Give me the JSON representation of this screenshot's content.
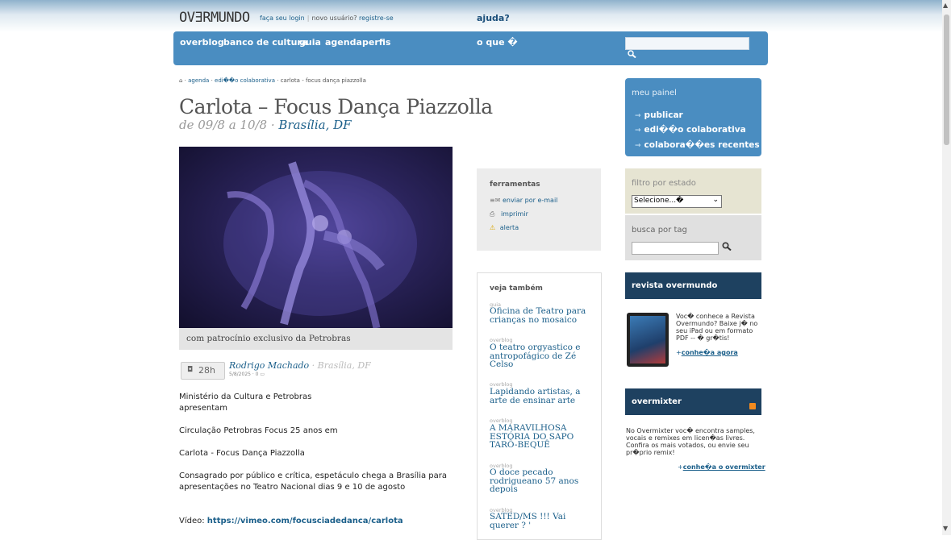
{
  "header": {
    "logo": "OV∃RMUNDO",
    "login": "faça seu login",
    "new_user": "novo usuário?",
    "register": "registre-se",
    "help": "ajuda?"
  },
  "nav": {
    "items": [
      "overblog",
      "banco de cultura",
      "guia",
      "agenda",
      "perfis"
    ],
    "what": "o que �"
  },
  "breadcrumb": {
    "home_icon": "home-icon",
    "agenda": "agenda",
    "edicao": "edi��o colaborativa",
    "current": "carlota - focus dança piazzolla"
  },
  "article": {
    "title": "Carlota – Focus Dança Piazzolla",
    "dates": "de 09/8 a 10/8 ·",
    "location": "Brasília, DF",
    "caption": "com patrocínio exclusivo da Petrobras",
    "time_badge": "28h",
    "author": "Rodrigo Machado",
    "author_location": "· Brasília, DF",
    "post_meta": "5/8/2025 · 0",
    "paragraphs": [
      "Ministério da Cultura e Petrobras",
      "apresentam",
      "Circulação Petrobras Focus 25 anos em",
      "Carlota - Focus Dança Piazzolla",
      "Consagrado por público e crítica, espetáculo chega a Brasília para",
      "apresentações no Teatro Nacional dias 9 e 10 de agosto"
    ],
    "video_label": "Vídeo:",
    "video_url": "https://vimeo.com/focusciadedanca/carlota"
  },
  "tools": {
    "title": "ferramentas",
    "items": [
      "enviar por e-mail",
      "imprimir",
      "alerta"
    ]
  },
  "related": {
    "title": "veja também",
    "items": [
      {
        "tag": "guia",
        "text": "Oficina de Teatro para crianças no mosaico"
      },
      {
        "tag": "overblog",
        "text": "O teatro orgyastico e antropofágico de Zé Celso"
      },
      {
        "tag": "overblog",
        "text": "Lapidando artistas, a arte de ensinar arte"
      },
      {
        "tag": "overblog",
        "text": "A MARAVILHOSA ESTÓRIA DO SAPO TARÔ-BEQUÊ"
      },
      {
        "tag": "overblog",
        "text": "O doce pecado rodrigueano 57 anos depois"
      },
      {
        "tag": "overblog",
        "text": "SATED/MS !!! Vai querer ? '"
      }
    ]
  },
  "panel": {
    "title": "meu painel",
    "items": [
      "publicar",
      "edi��o colaborativa",
      "colabora��es recentes"
    ]
  },
  "filter": {
    "title": "filtro por estado",
    "select_value": "Selecione...�"
  },
  "tag_search": {
    "title": "busca por tag"
  },
  "magazine": {
    "title": "revista overmundo",
    "text": "Voc� conhece a Revista Overmundo? Baixe j� no seu iPad ou em formato PDF -- � gr�tis!",
    "link_prefix": "+",
    "link": "conhe�a agora"
  },
  "overmixter": {
    "title": "overmixter",
    "text": "No Overmixter voc� encontra samples, vocais e remixes em licen�as livres. Confira os mais votados, ou envie seu pr�prio remix!",
    "link_prefix": "+",
    "link": "conhe�a o overmixter"
  }
}
